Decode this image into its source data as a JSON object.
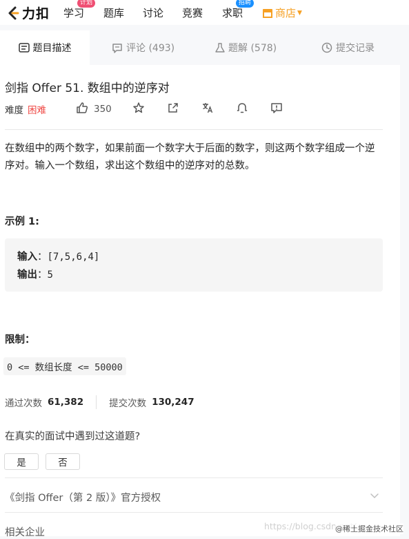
{
  "nav": {
    "logo_text": "力扣",
    "items": [
      {
        "label": "学习",
        "badge": "计划"
      },
      {
        "label": "题库"
      },
      {
        "label": "讨论"
      },
      {
        "label": "竞赛"
      },
      {
        "label": "求职",
        "badge": "招聘"
      },
      {
        "label": "商店"
      }
    ],
    "accent": "#f6a023"
  },
  "tabs": [
    {
      "label": "题目描述",
      "icon": "document-icon",
      "active": true
    },
    {
      "label": "评论 (493)",
      "icon": "comment-icon"
    },
    {
      "label": "题解 (578)",
      "icon": "flask-icon"
    },
    {
      "label": "提交记录",
      "icon": "clock-icon"
    }
  ],
  "problem": {
    "title": "剑指 Offer 51. 数组中的逆序对",
    "difficulty_label": "难度",
    "difficulty": "困难",
    "difficulty_color": "#ef4743",
    "likes": "350",
    "description": "在数组中的两个数字，如果前面一个数字大于后面的数字，则这两个数字组成一个逆序对。输入一个数组，求出这个数组中的逆序对的总数。",
    "example_title": "示例 1:",
    "example": {
      "input_label": "输入",
      "input_value": "[7,5,6,4]",
      "output_label": "输出",
      "output_value": "5"
    },
    "limit_title": "限制：",
    "limit_code": "0 <= 数组长度 <= 50000"
  },
  "stats": {
    "accepted_label": "通过次数",
    "accepted": "61,382",
    "submitted_label": "提交次数",
    "submitted": "130,247"
  },
  "feedback": {
    "question": "在真实的面试中遇到过这道题?",
    "yes": "是",
    "no": "否"
  },
  "source": "《剑指 Offer（第 2 版）》官方授权",
  "related": "相关企业",
  "watermark": "https://blog.csdn.net/...",
  "watermark2": "@稀土掘金技术社区"
}
